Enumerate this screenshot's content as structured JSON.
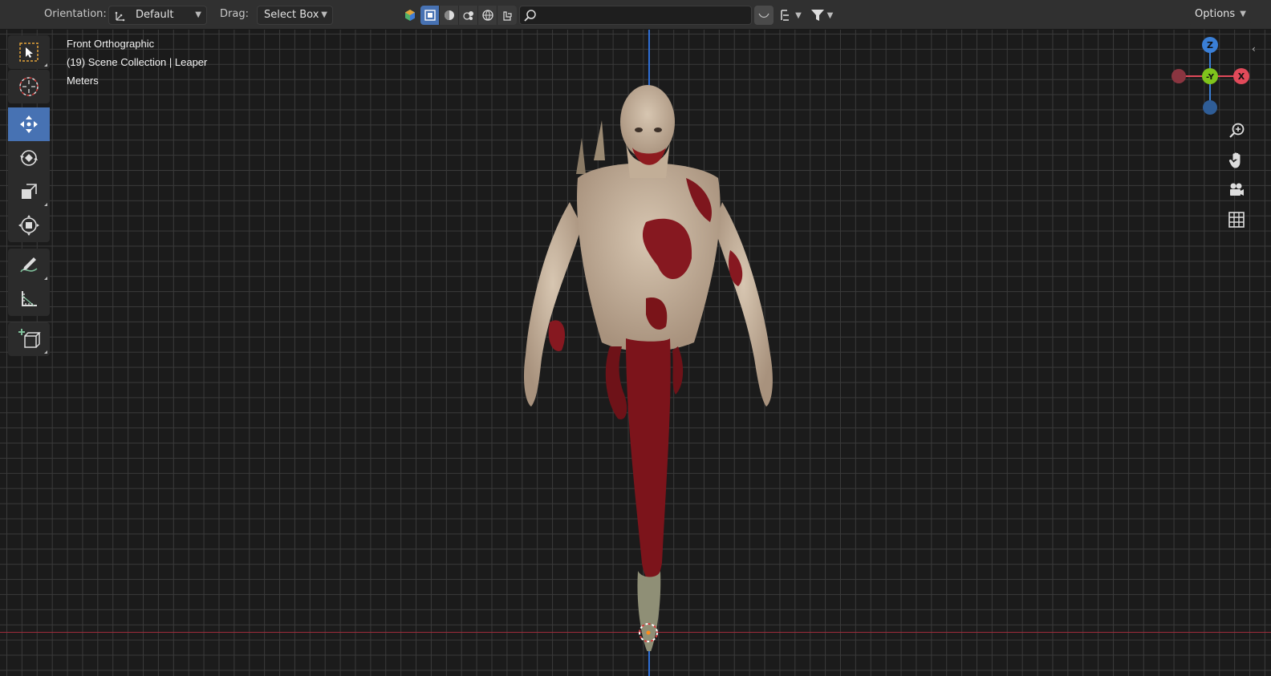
{
  "header": {
    "orientation_label": "Orientation:",
    "orientation_value": "Default",
    "drag_label": "Drag:",
    "drag_value": "Select Box",
    "search_placeholder": "",
    "options_label": "Options"
  },
  "viewport": {
    "view_name": "Front Orthographic",
    "collection_info": "(19) Scene Collection | Leaper",
    "units": "Meters",
    "axis_x_color": "#9c2c3a",
    "axis_z_color": "#2e6fd6"
  },
  "gizmo": {
    "z_label": "Z",
    "y_label": "-Y",
    "x_label": "X",
    "x_color": "#e14a5a",
    "y_color": "#7fc41c",
    "z_color": "#3a7fd6"
  },
  "toolbar": {
    "tools": [
      "select-box-tool",
      "cursor-tool",
      "move-tool",
      "rotate-tool",
      "scale-tool",
      "transform-tool",
      "annotate-tool",
      "measure-tool",
      "add-cube-tool"
    ],
    "active": "move-tool",
    "accent": "#4772b3"
  }
}
